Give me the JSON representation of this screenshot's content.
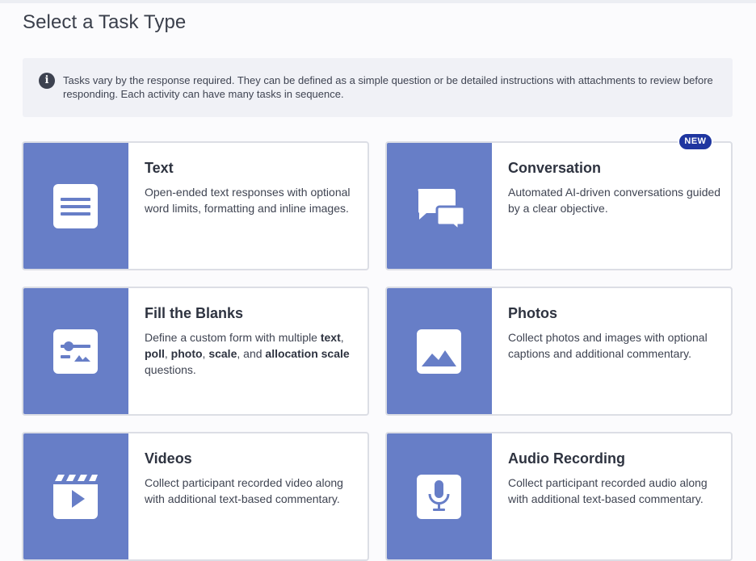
{
  "page": {
    "title": "Select a Task Type"
  },
  "info": {
    "icon": "info-icon",
    "text": "Tasks vary by the response required. They can be defined as a simple question or be detailed instructions with attachments to review before responding. Each activity can have many tasks in sequence."
  },
  "colors": {
    "art_bg": "#677ec7",
    "badge_bg": "#1f36a0",
    "card_border": "#dcdee5"
  },
  "cards": [
    {
      "title": "Text",
      "icon": "text-lines-icon",
      "desc": "Open-ended text responses with optional word limits, formatting and inline images."
    },
    {
      "title": "Conversation",
      "icon": "chat-bubbles-icon",
      "badge": "NEW",
      "desc": "Automated AI-driven conversations guided by a clear objective."
    },
    {
      "title": "Fill the Blanks",
      "icon": "form-fields-icon",
      "desc_parts": [
        "Define a custom form with multiple ",
        "text",
        ", ",
        "poll",
        ", ",
        "photo",
        ", ",
        "scale",
        ", and ",
        "allocation scale",
        " questions."
      ]
    },
    {
      "title": "Photos",
      "icon": "image-icon",
      "desc": "Collect photos and images with optional captions and additional commentary."
    },
    {
      "title": "Videos",
      "icon": "video-clapper-icon",
      "desc": "Collect participant recorded video along with additional text-based commentary."
    },
    {
      "title": "Audio Recording",
      "icon": "microphone-icon",
      "desc": "Collect participant recorded audio along with additional text-based commentary."
    }
  ]
}
